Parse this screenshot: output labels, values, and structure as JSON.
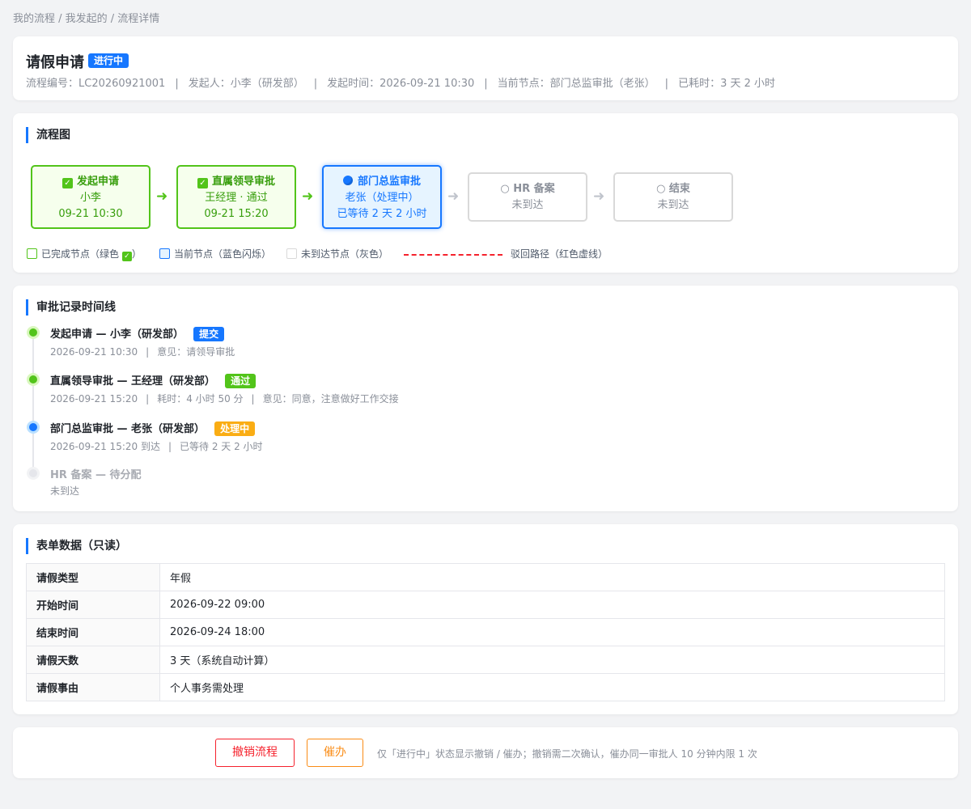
{
  "breadcrumb": "我的流程 / 我发起的 / 流程详情",
  "header": {
    "title": "请假申请",
    "status": "进行中",
    "meta": {
      "flow_no": "流程编号：LC20260921001",
      "initiator": "发起人：小李（研发部）",
      "start_time": "发起时间：2026-09-21 10:30",
      "current_node": "当前节点：部门总监审批（老张）",
      "elapsed": "已耗时：3 天 2 小时"
    }
  },
  "flow": {
    "title": "流程图",
    "nodes": [
      {
        "name": "发起申请",
        "line1": "小李",
        "line2": "09-21 10:30",
        "state": "done"
      },
      {
        "name": "直属领导审批",
        "line1": "王经理 · 通过",
        "line2": "09-21 15:20",
        "state": "done"
      },
      {
        "name": "部门总监审批",
        "line1": "老张（处理中）",
        "line2": "已等待 2 天 2 小时",
        "state": "current"
      },
      {
        "name": "○ HR 备案",
        "line1": "未到达",
        "state": "pending"
      },
      {
        "name": "○ 结束",
        "line1": "未到达",
        "state": "pending"
      }
    ],
    "arrow": "➜",
    "legend": {
      "done_pre": "已完成节点（绿色",
      "done_post": "）",
      "current": "当前节点（蓝色闪烁）",
      "pending": "未到达节点（灰色）",
      "reject": "驳回路径（红色虚线）"
    },
    "colors": {
      "done": "#52c41a",
      "current": "#1677ff",
      "pending": "#d9d9d9",
      "reject": "#f5222d"
    }
  },
  "timeline": {
    "title": "审批记录时间线",
    "items": [
      {
        "head": "发起申请 — 小李（研发部）",
        "tag": "提交",
        "sub": [
          "2026-09-21 10:30",
          "意见：请领导审批"
        ]
      },
      {
        "head": "直属领导审批 — 王经理（研发部）",
        "tag": "通过",
        "sub": [
          "2026-09-21 15:20",
          "耗时：4 小时 50 分",
          "意见：同意，注意做好工作交接"
        ]
      },
      {
        "head": "部门总监审批 — 老张（研发部）",
        "tag": "处理中",
        "sub": [
          "2026-09-21 15:20 到达",
          "已等待 2 天 2 小时"
        ]
      },
      {
        "head": "HR 备案 — 待分配",
        "sub": [
          "未到达"
        ]
      }
    ],
    "separator": "|"
  },
  "form": {
    "title": "表单数据（只读）",
    "rows": [
      {
        "k": "请假类型",
        "v": "年假"
      },
      {
        "k": "开始时间",
        "v": "2026-09-22 09:00"
      },
      {
        "k": "结束时间",
        "v": "2026-09-24 18:00"
      },
      {
        "k": "请假天数",
        "v": "3 天（系统自动计算）"
      },
      {
        "k": "请假事由",
        "v": "个人事务需处理"
      }
    ]
  },
  "actions": {
    "cancel": "撤销流程",
    "urge": "催办",
    "hint": "仅「进行中」状态显示撤销 / 催办；撤销需二次确认，催办同一审批人 10 分钟内限 1 次"
  }
}
